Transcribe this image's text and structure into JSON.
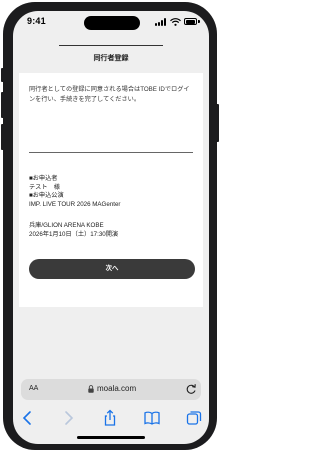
{
  "status_bar": {
    "time": "9:41"
  },
  "page": {
    "title": "同行者登録",
    "notice": "同行者としての登録に同意される場合はTOBE IDでログインを行い、手続きを完了してください。",
    "applicant_heading": "■お申込者",
    "applicant_name": "テスト　様",
    "performance_heading": "■お申込公演",
    "performance_name": "IMP. LIVE TOUR 2026 MAGenter",
    "venue": "兵庫/GLION ARENA KOBE",
    "datetime": "2026年1月10日（土）17:30開演",
    "next_button": "次へ"
  },
  "browser": {
    "aa_label": "AA",
    "url": "moala.com"
  },
  "icons": {
    "status": [
      "signal-icon",
      "wifi-icon",
      "battery-icon"
    ],
    "address": [
      "lock-icon",
      "reload-icon"
    ],
    "toolbar": [
      "back-icon",
      "forward-icon",
      "share-icon",
      "bookmarks-icon",
      "tabs-icon"
    ]
  },
  "colors": {
    "accent_blue": "#1a73e8",
    "button_dark": "#3a3a3a",
    "page_bg": "#efefef"
  }
}
